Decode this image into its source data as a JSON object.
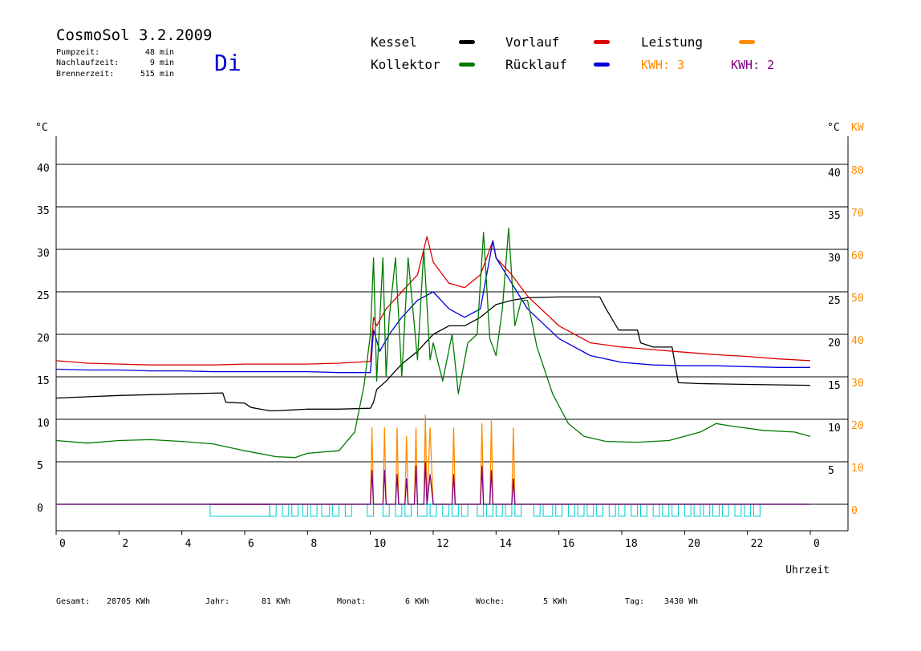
{
  "header": {
    "title": "CosmoSol 3.2.2009",
    "weekday": "Di",
    "stats": [
      {
        "label": "Pumpzeit:",
        "value": "48 min"
      },
      {
        "label": "Nachlaufzeit:",
        "value": "9 min"
      },
      {
        "label": "Brennerzeit:",
        "value": "515 min"
      }
    ]
  },
  "legend": {
    "kessel": "Kessel",
    "kollektor": "Kollektor",
    "vorlauf": "Vorlauf",
    "ruecklauf": "Rücklauf",
    "leistung": "Leistung",
    "kwh_a": "KWH: 3",
    "kwh_b": "KWH: 2"
  },
  "footer": {
    "gesamt_label": "Gesamt:",
    "gesamt_value": "28705 KWh",
    "jahr_label": "Jahr:",
    "jahr_value": "81 KWh",
    "monat_label": "Monat:",
    "monat_value": "6 KWh",
    "woche_label": "Woche:",
    "woche_value": "5 KWh",
    "tag_label": "Tag:",
    "tag_value": "3430 Wh"
  },
  "chart_data": {
    "type": "line",
    "xlabel": "Uhrzeit",
    "ylabel_left": "°C",
    "ylabel_right_temp": "°C",
    "ylabel_right_power": "KW",
    "xlim": [
      0,
      24
    ],
    "ylim": [
      0,
      45
    ],
    "x_ticks": [
      "0",
      "2",
      "4",
      "6",
      "8",
      "10",
      "12",
      "14",
      "16",
      "18",
      "20",
      "22",
      "0"
    ],
    "y_ticks_left": [
      "0",
      "5",
      "10",
      "15",
      "20",
      "25",
      "30",
      "35",
      "40"
    ],
    "y_ticks_right_temp": [
      "5",
      "10",
      "15",
      "20",
      "25",
      "30",
      "35",
      "40"
    ],
    "y_ticks_right_power": [
      "0",
      "10",
      "20",
      "30",
      "40",
      "50",
      "60",
      "70",
      "80"
    ],
    "grid": true,
    "legend_position": "top",
    "colors": {
      "kessel": "#000000",
      "kollektor": "#007a00",
      "vorlauf": "#dd0000",
      "ruecklauf": "#0000dd",
      "leistung": "#ff8c00",
      "kwh_b": "#800080",
      "pump": "#00cccc"
    },
    "series": [
      {
        "name": "Kessel",
        "color": "#000000",
        "x": [
          0,
          2,
          4,
          5.3,
          5.4,
          6,
          6.2,
          6.8,
          7,
          7.5,
          8,
          9,
          10,
          10.1,
          10.2,
          10.5,
          11,
          11.5,
          12,
          12.5,
          13,
          13.5,
          14,
          14.5,
          15,
          16,
          17,
          17.3,
          17.5,
          17.9,
          18.5,
          18.6,
          19,
          19.6,
          19.8,
          20.5,
          22,
          24
        ],
        "y": [
          12.5,
          12.8,
          13.0,
          13.1,
          12.0,
          11.9,
          11.4,
          11.0,
          11.0,
          11.1,
          11.2,
          11.2,
          11.3,
          12.0,
          13.5,
          14.5,
          16.5,
          18.0,
          20.0,
          21.0,
          21.0,
          22.0,
          23.5,
          24.0,
          24.3,
          24.4,
          24.4,
          24.4,
          23.0,
          20.5,
          20.5,
          19.0,
          18.5,
          18.5,
          14.3,
          14.2,
          14.1,
          14.0
        ]
      },
      {
        "name": "Vorlauf",
        "color": "#dd0000",
        "x": [
          0,
          1,
          2,
          3,
          4,
          5,
          6,
          7,
          8,
          9,
          10,
          10.1,
          10.2,
          10.5,
          11,
          11.5,
          11.8,
          11.9,
          12,
          12.5,
          13,
          13.5,
          13.9,
          14,
          14.5,
          15,
          16,
          17,
          18,
          19,
          20,
          21,
          22,
          23,
          24
        ],
        "y": [
          16.9,
          16.6,
          16.5,
          16.4,
          16.4,
          16.4,
          16.5,
          16.5,
          16.5,
          16.6,
          16.8,
          22.0,
          21.0,
          23.0,
          25.0,
          27.0,
          31.5,
          30.0,
          28.5,
          26.0,
          25.5,
          27.0,
          31.0,
          29.0,
          27.0,
          24.5,
          21.0,
          19.0,
          18.5,
          18.2,
          17.9,
          17.6,
          17.4,
          17.1,
          16.9
        ]
      },
      {
        "name": "Rücklauf",
        "color": "#0000dd",
        "x": [
          0,
          1,
          2,
          3,
          4,
          5,
          6,
          7,
          8,
          9,
          10,
          10.1,
          10.3,
          10.6,
          11,
          11.5,
          12,
          12.5,
          13,
          13.5,
          13.9,
          14,
          14.5,
          15,
          16,
          17,
          18,
          19,
          20,
          21,
          22,
          23,
          24
        ],
        "y": [
          15.9,
          15.8,
          15.8,
          15.7,
          15.7,
          15.6,
          15.6,
          15.6,
          15.6,
          15.5,
          15.5,
          20.5,
          18.0,
          20.0,
          22.0,
          24.0,
          25.0,
          23.0,
          22.0,
          23.0,
          31.0,
          29.0,
          26.0,
          23.0,
          19.5,
          17.5,
          16.7,
          16.4,
          16.3,
          16.3,
          16.2,
          16.1,
          16.1
        ]
      },
      {
        "name": "Kollektor",
        "color": "#007a00",
        "x": [
          0,
          1,
          2,
          3,
          4,
          5,
          6,
          7,
          7.6,
          8,
          9,
          9.5,
          9.8,
          10,
          10.1,
          10.2,
          10.4,
          10.5,
          10.6,
          10.8,
          11,
          11.2,
          11.5,
          11.7,
          11.9,
          12,
          12.3,
          12.6,
          12.8,
          13.1,
          13.4,
          13.6,
          13.8,
          14.0,
          14.2,
          14.4,
          14.6,
          14.8,
          15.0,
          15.3,
          15.8,
          16.3,
          16.8,
          17.5,
          18.5,
          19.5,
          20.5,
          21,
          21.5,
          22.5,
          23.5,
          24
        ],
        "y": [
          7.5,
          7.2,
          7.5,
          7.6,
          7.4,
          7.1,
          6.3,
          5.6,
          5.5,
          6.0,
          6.3,
          8.5,
          14.0,
          20.0,
          29.0,
          14.5,
          29.0,
          15.0,
          22.0,
          29.0,
          15.0,
          29.0,
          17.0,
          30.0,
          17.0,
          19.0,
          14.5,
          20.0,
          13.0,
          19.0,
          20.0,
          32.0,
          19.5,
          17.5,
          23.0,
          32.5,
          21.0,
          24.0,
          24.0,
          18.5,
          13.0,
          9.5,
          8.0,
          7.4,
          7.3,
          7.5,
          8.5,
          9.5,
          9.2,
          8.7,
          8.5,
          8.0
        ]
      },
      {
        "name": "Leistung",
        "color": "#ff8c00",
        "x": [
          0,
          10.0,
          10.05,
          10.1,
          10.4,
          10.45,
          10.5,
          10.8,
          10.85,
          10.9,
          11.1,
          11.15,
          11.2,
          11.4,
          11.45,
          11.5,
          11.7,
          11.75,
          11.8,
          11.9,
          12.0,
          12.6,
          12.65,
          12.7,
          13.5,
          13.55,
          13.6,
          13.8,
          13.85,
          13.9,
          14.5,
          14.55,
          14.6,
          15,
          24
        ],
        "y": [
          0,
          0,
          9.0,
          0,
          0,
          9.0,
          0,
          0,
          9.0,
          0,
          0,
          8.0,
          0,
          0,
          9.0,
          0,
          0,
          10.5,
          0,
          9.0,
          0,
          0,
          9.0,
          0,
          0,
          9.5,
          0,
          0,
          10.0,
          0,
          0,
          9.0,
          0,
          0,
          0
        ]
      },
      {
        "name": "KWH: 2",
        "color": "#800080",
        "x": [
          0,
          10.0,
          10.05,
          10.1,
          10.4,
          10.45,
          10.5,
          10.8,
          10.85,
          10.9,
          11.1,
          11.15,
          11.2,
          11.4,
          11.45,
          11.5,
          11.7,
          11.75,
          11.8,
          11.9,
          12.0,
          12.6,
          12.65,
          12.7,
          13.5,
          13.55,
          13.6,
          13.8,
          13.85,
          13.9,
          14.5,
          14.55,
          14.6,
          15,
          24
        ],
        "y": [
          0,
          0,
          4.0,
          0,
          0,
          4.0,
          0,
          0,
          3.5,
          0,
          0,
          3.0,
          0,
          0,
          4.5,
          0,
          0,
          5.0,
          0,
          3.5,
          0,
          0,
          3.5,
          0,
          0,
          4.5,
          0,
          0,
          4.0,
          0,
          0,
          3.0,
          0,
          0,
          0
        ]
      }
    ],
    "pump_segments": [
      [
        4.9,
        6.8
      ],
      [
        6.8,
        7.0
      ],
      [
        7.2,
        7.4
      ],
      [
        7.5,
        7.7
      ],
      [
        7.85,
        8.0
      ],
      [
        8.1,
        8.3
      ],
      [
        8.45,
        8.7
      ],
      [
        8.8,
        9.0
      ],
      [
        9.2,
        9.4
      ],
      [
        9.9,
        10.1
      ],
      [
        10.4,
        10.6
      ],
      [
        10.8,
        11.0
      ],
      [
        11.1,
        11.3
      ],
      [
        11.5,
        11.8
      ],
      [
        11.9,
        12.1
      ],
      [
        12.3,
        12.5
      ],
      [
        12.6,
        12.8
      ],
      [
        12.9,
        13.1
      ],
      [
        13.4,
        13.6
      ],
      [
        13.7,
        13.9
      ],
      [
        14.0,
        14.2
      ],
      [
        14.3,
        14.5
      ],
      [
        14.6,
        14.8
      ],
      [
        15.2,
        15.4
      ],
      [
        15.5,
        15.8
      ],
      [
        15.9,
        16.1
      ],
      [
        16.3,
        16.5
      ],
      [
        16.6,
        16.8
      ],
      [
        16.9,
        17.1
      ],
      [
        17.2,
        17.4
      ],
      [
        17.6,
        17.8
      ],
      [
        17.9,
        18.1
      ],
      [
        18.3,
        18.5
      ],
      [
        18.6,
        18.8
      ],
      [
        19.0,
        19.2
      ],
      [
        19.3,
        19.5
      ],
      [
        19.6,
        19.8
      ],
      [
        20.0,
        20.2
      ],
      [
        20.3,
        20.5
      ],
      [
        20.6,
        20.8
      ],
      [
        20.9,
        21.1
      ],
      [
        21.2,
        21.4
      ],
      [
        21.6,
        21.8
      ],
      [
        21.9,
        22.1
      ],
      [
        22.2,
        22.4
      ]
    ]
  }
}
